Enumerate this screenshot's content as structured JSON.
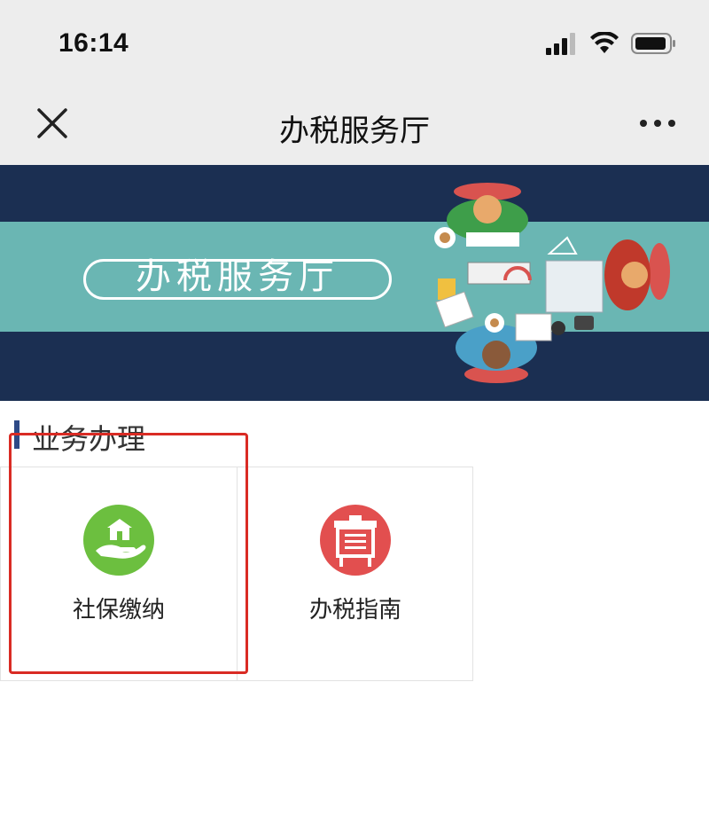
{
  "status_bar": {
    "time": "16:14"
  },
  "nav": {
    "title": "办税服务厅"
  },
  "banner": {
    "title": "办税服务厅"
  },
  "section": {
    "title": "业务办理"
  },
  "services": [
    {
      "label": "社保缴纳",
      "icon": "hand-house-icon",
      "color": "#6cbf3f"
    },
    {
      "label": "办税指南",
      "icon": "easel-board-icon",
      "color": "#e24f4f"
    }
  ],
  "colors": {
    "nav_bg": "#ededed",
    "banner_dark": "#1b2f52",
    "banner_band": "#6ab6b3",
    "section_accent": "#2e4a86",
    "highlight": "#d92b24"
  }
}
